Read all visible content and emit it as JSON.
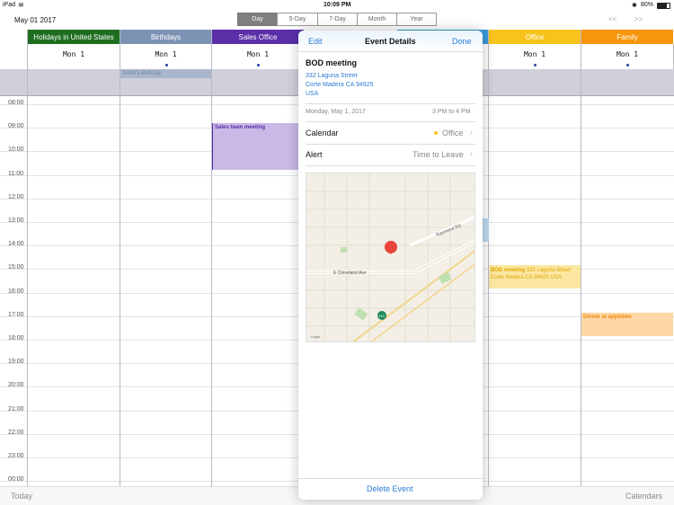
{
  "status": {
    "device": "iPad",
    "time": "10:09 PM",
    "battery": "80%"
  },
  "toolbar": {
    "date": "May 01 2017",
    "views": [
      "Day",
      "5-Day",
      "7-Day",
      "Month",
      "Year"
    ],
    "prev": "<<",
    "next": ">>"
  },
  "calendars": [
    {
      "name": "Holidays in United States",
      "color": "#1f6e20"
    },
    {
      "name": "Birthdays",
      "color": "#7d93b4"
    },
    {
      "name": "Sales Office",
      "color": "#5a2fa8"
    },
    {
      "name": "",
      "color": "#fff"
    },
    {
      "name": "",
      "color": "#fff"
    },
    {
      "name": "Office",
      "color": "#f7c31c"
    },
    {
      "name": "Family",
      "color": "#f7950c"
    }
  ],
  "day_label": "Mon 1",
  "all_day_events": {
    "birthday": "Smith's Birthday"
  },
  "hours": [
    "08:00",
    "09:00",
    "10:00",
    "11:00",
    "12:00",
    "13:00",
    "14:00",
    "15:00",
    "16:00",
    "17:00",
    "18:00",
    "19:00",
    "20:00",
    "21:00",
    "22:00",
    "23:00",
    "00:00"
  ],
  "events": {
    "sales": "Sales team meeting",
    "bod": "BOD meeting",
    "bod_loc": "332 Laguna Street  Corte Madera CA 94925  USA",
    "dinner": "Dinner at applebee"
  },
  "popover": {
    "edit": "Edit",
    "title": "Event Details",
    "done": "Done",
    "event_title": "BOD meeting",
    "address": [
      "332 Laguna Street",
      "Corte Madera CA 94925",
      "USA"
    ],
    "date": "Monday, May 1, 2017",
    "time": "3 PM to 4 PM",
    "calendar_label": "Calendar",
    "calendar_value": "Office",
    "alert_label": "Alert",
    "alert_value": "Time to Leave",
    "map_streets": [
      "E Cleveland Ave",
      "Raymond Rd"
    ],
    "map_route": "143",
    "map_legal": "Legal",
    "delete": "Delete Event"
  },
  "bottom": {
    "today": "Today",
    "calendars": "Calendars"
  }
}
